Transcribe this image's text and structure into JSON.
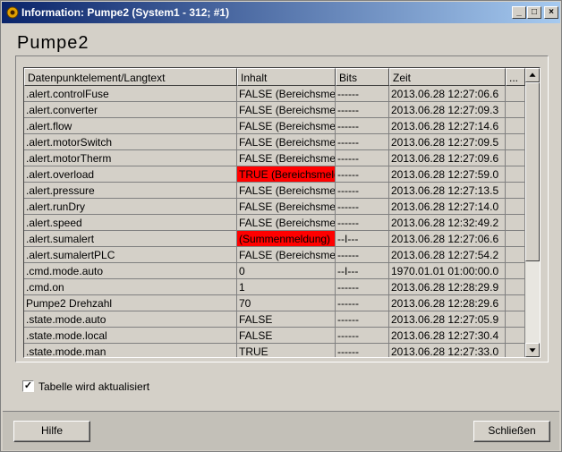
{
  "window": {
    "title": "Information: Pumpe2 (System1 - 312; #1)",
    "minimize_label": "_",
    "maximize_label": "□",
    "close_label": "×"
  },
  "heading": "Pumpe2",
  "table": {
    "columns": [
      "Datenpunktelement/Langtext",
      "Inhalt",
      "Bits",
      "Zeit",
      "..."
    ],
    "rows": [
      {
        "element": ".alert.controlFuse",
        "content": "FALSE (Bereichsmeldung)",
        "bits": "------",
        "time": "2013.06.28 12:27:06.6",
        "alarm": false
      },
      {
        "element": ".alert.converter",
        "content": "FALSE (Bereichsmeldung)",
        "bits": "------",
        "time": "2013.06.28 12:27:09.3",
        "alarm": false
      },
      {
        "element": ".alert.flow",
        "content": "FALSE (Bereichsmeldung)",
        "bits": "------",
        "time": "2013.06.28 12:27:14.6",
        "alarm": false
      },
      {
        "element": ".alert.motorSwitch",
        "content": "FALSE (Bereichsmeldung)",
        "bits": "------",
        "time": "2013.06.28 12:27:09.5",
        "alarm": false
      },
      {
        "element": ".alert.motorTherm",
        "content": "FALSE (Bereichsmeldung)",
        "bits": "------",
        "time": "2013.06.28 12:27:09.6",
        "alarm": false
      },
      {
        "element": ".alert.overload",
        "content": "TRUE (Bereichsmeldung)",
        "bits": "------",
        "time": "2013.06.28 12:27:59.0",
        "alarm": true
      },
      {
        "element": ".alert.pressure",
        "content": "FALSE (Bereichsmeldung)",
        "bits": "------",
        "time": "2013.06.28 12:27:13.5",
        "alarm": false
      },
      {
        "element": ".alert.runDry",
        "content": "FALSE (Bereichsmeldung)",
        "bits": "------",
        "time": "2013.06.28 12:27:14.0",
        "alarm": false
      },
      {
        "element": ".alert.speed",
        "content": "FALSE (Bereichsmeldung)",
        "bits": "------",
        "time": "2013.06.28 12:32:49.2",
        "alarm": false
      },
      {
        "element": ".alert.sumalert",
        "content": "(Summenmeldung)",
        "bits": "--I---",
        "time": "2013.06.28 12:27:06.6",
        "alarm": true
      },
      {
        "element": ".alert.sumalertPLC",
        "content": "FALSE (Bereichsmeldung)",
        "bits": "------",
        "time": "2013.06.28 12:27:54.2",
        "alarm": false
      },
      {
        "element": ".cmd.mode.auto",
        "content": "0",
        "bits": "--I---",
        "time": "1970.01.01 01:00:00.0",
        "alarm": false
      },
      {
        "element": ".cmd.on",
        "content": "1",
        "bits": "------",
        "time": "2013.06.28 12:28:29.9",
        "alarm": false
      },
      {
        "element": "Pumpe2 Drehzahl",
        "content": "70",
        "bits": "------",
        "time": "2013.06.28 12:28:29.6",
        "alarm": false
      },
      {
        "element": ".state.mode.auto",
        "content": "FALSE",
        "bits": "------",
        "time": "2013.06.28 12:27:05.9",
        "alarm": false
      },
      {
        "element": ".state.mode.local",
        "content": "FALSE",
        "bits": "------",
        "time": "2013.06.28 12:27:30.4",
        "alarm": false
      },
      {
        "element": ".state.mode.man",
        "content": "TRUE",
        "bits": "------",
        "time": "2013.06.28 12:27:33.0",
        "alarm": false
      }
    ]
  },
  "auto_update": {
    "label": "Tabelle wird aktualisiert",
    "checked": true,
    "check_mark": "✓"
  },
  "buttons": {
    "help": "Hilfe",
    "close": "Schließen"
  },
  "colors": {
    "alarm": "#ff0000",
    "titlebar_start": "#0a246a",
    "titlebar_end": "#a6caf0"
  }
}
